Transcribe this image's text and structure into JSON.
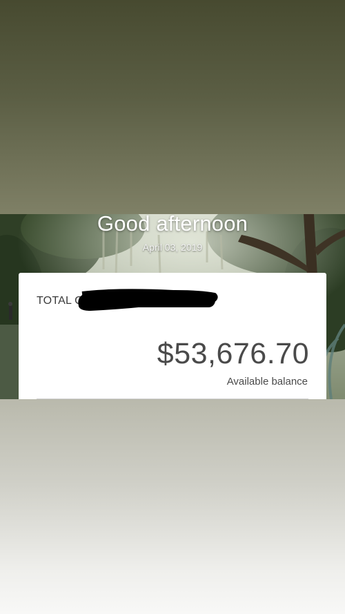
{
  "header": {
    "greeting": "Good afternoon",
    "date": "April 03, 2019"
  },
  "account_card": {
    "title_partial": "TOTAL C",
    "title_redacted": true,
    "balance": "$53,676.70",
    "balance_label": "Available balance"
  },
  "colors": {
    "card_background": "#ffffff",
    "balance_text": "#4a4a4a",
    "top_band": "#5b5e44",
    "bottom_band": "#d0d0c8"
  }
}
